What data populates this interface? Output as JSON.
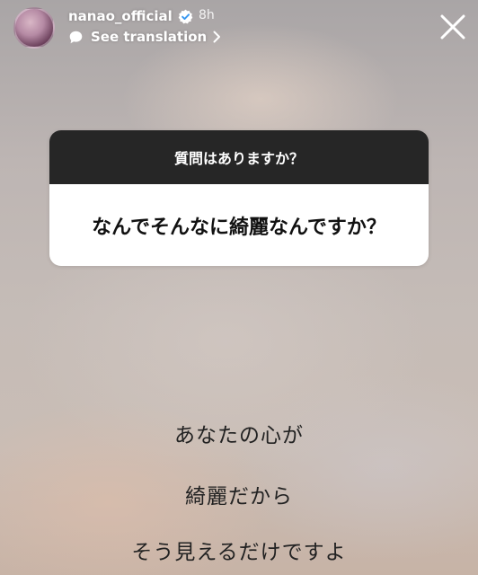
{
  "header": {
    "username": "nanao_official",
    "time": "8h",
    "translate_label": "See translation",
    "icons": {
      "verified": "verified-badge-icon",
      "translate": "translate-speech-bubble-icon",
      "chevron": "chevron-right-icon",
      "close": "close-icon"
    }
  },
  "question_card": {
    "prompt": "質問はありますか？",
    "question": "なんでそんなに綺麗なんですか？"
  },
  "answer": {
    "lines": [
      "あなたの心が",
      "綺麗だから",
      "そう見えるだけですよ"
    ]
  },
  "colors": {
    "card_header": "#262626",
    "card_body": "#ffffff",
    "verified_blue": "#3897f0"
  }
}
